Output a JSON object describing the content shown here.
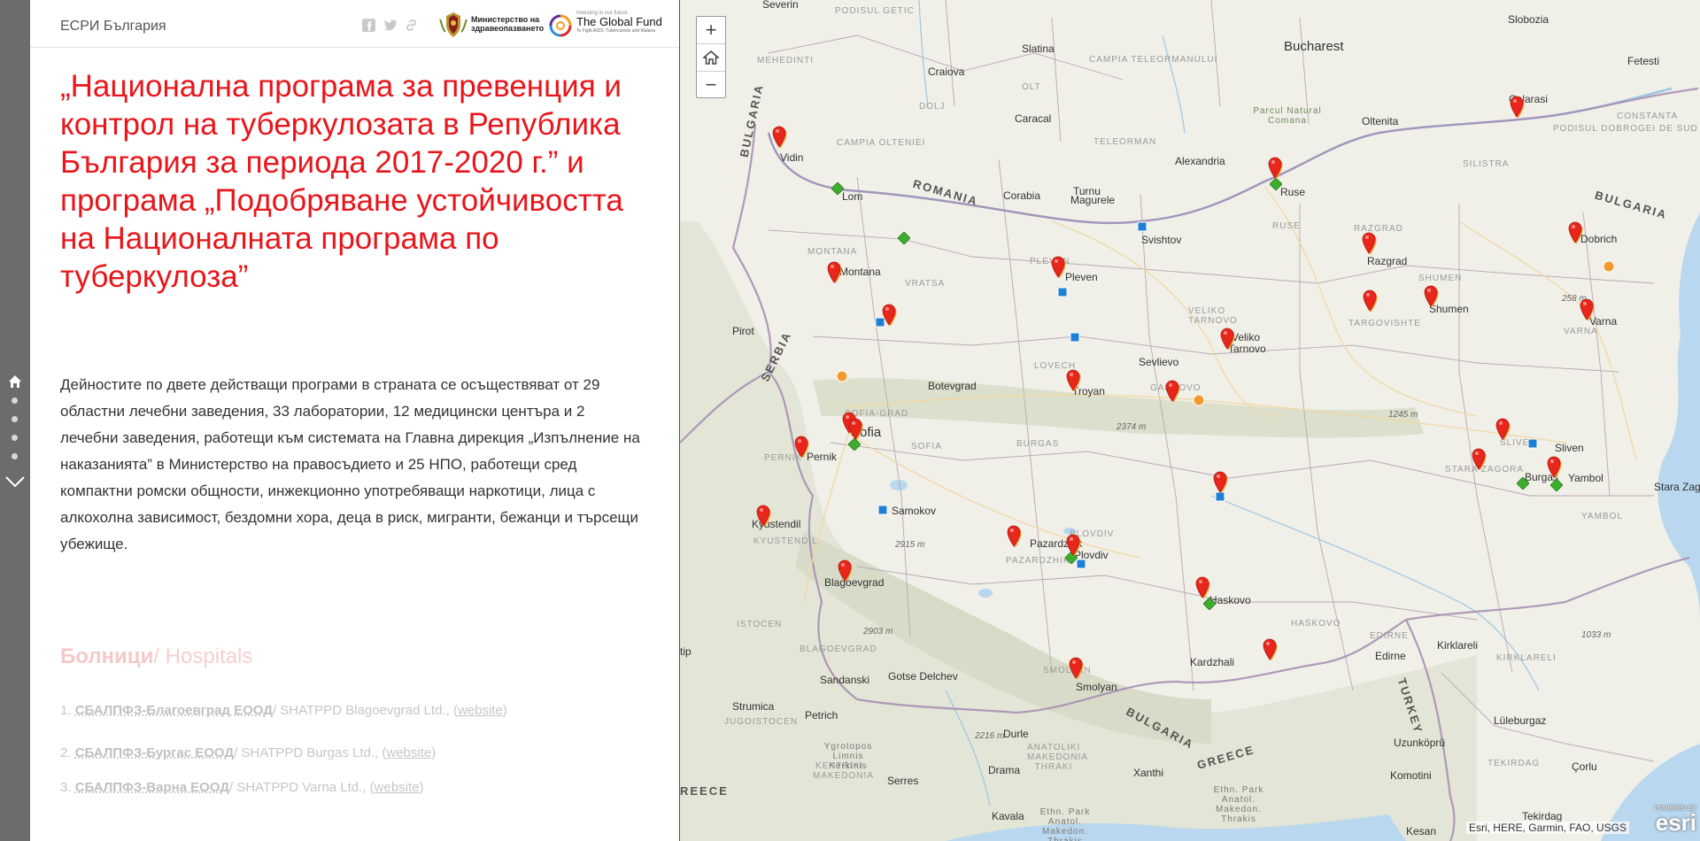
{
  "header": {
    "brand": "ЕСРИ България",
    "logo_moh": "Министерство на здравеопазването",
    "logo_gf_tagline": "Investing in our future",
    "logo_gf_name": "The Global Fund",
    "logo_gf_sub": "To Fight AIDS, Tuberculosis and Malaria"
  },
  "title": "„Национална програма за превенция и контрол на туберкулозата в Република България за периода 2017-2020 г.” и програма „Подобряване устойчивостта на Националната програма по туберкулоза”",
  "intro": "Дейностите по двете действащи програми в страната се осъществяват от 29 областни лечебни заведения, 33 лаборатории, 12 медицински центъра и 2 лечебни заведения, работещи към системата на Главна дирекция „Изпълнение на наказанията” в Министерство на правосъдието и 25 НПО, работещи сред компактни ромски общности, инжекционно употребяващи наркотици, лица с алкохолна зависимост, бездомни хора, деца в риск, мигранти, бежанци и търсещи убежище.",
  "hospitals": {
    "heading_bg": "Болници",
    "heading_en": "/ Hospitals",
    "items": [
      {
        "num": "1.",
        "bg": "СБАЛПФЗ-Благоевград ЕООД",
        "en": "/ SHATPPD Blagoevgrad Ltd., (",
        "link": "website",
        "close": ")"
      },
      {
        "num": "2.",
        "bg": "СБАЛПФЗ-Бургас ЕООД",
        "en": "/ SHATPPD Burgas Ltd., (",
        "link": "website",
        "close": ")"
      },
      {
        "num": "3.",
        "bg": "СБАЛПФЗ-Варна ЕООД",
        "en": "/ SHATPPD Varna Ltd., (",
        "link": "website",
        "close": ")"
      }
    ]
  },
  "map": {
    "zoom_in": "+",
    "zoom_out": "−",
    "attribution": "Esri, HERE, Garmin, FAO, USGS",
    "esri_powered": "POWERED BY",
    "esri_name": "esri",
    "labels": {
      "bucharest": "Bucharest",
      "severin": "Severin",
      "slatina": "Slatina",
      "craiova": "Craiova",
      "caracal": "Caracal",
      "olt": "OLT",
      "alexandria": "Alexandria",
      "turnu": "Turnu",
      "magurele": "Magurele",
      "corabia": "Corabia",
      "giurgiu_area": "CAMPIA TELEORMANULUI",
      "teleorman": "TELEORMAN",
      "campia_olteniei": "CAMPIA OLTENIEI",
      "mehedinti": "MEHEDINTI",
      "dolj": "DOLJ",
      "podisul_getic": "PODISUL GETIC",
      "romania": "ROMANIA",
      "oltenita": "Oltenita",
      "calarasi": "Calarasi",
      "slobozia": "Slobozia",
      "fetesti": "Fetesti",
      "constanta": "CONSTANTA",
      "podisul_dobrogei": "PODISUL DOBROGEI DE SUD",
      "parcul": "Parcul Natural Comana",
      "silistra": "SILISTRA",
      "bulgaria_ne": "BULGARIA",
      "vidin": "Vidin",
      "lom": "Lom",
      "montana": "Montana",
      "montana_r": "MONTANA",
      "vratsa": "VRATSA",
      "pleven": "Pleven",
      "pleven_r": "PLEVEN",
      "svishtov": "Svishtov",
      "ruse": "Ruse",
      "ruse_r": "RUSE",
      "razgrad": "Razgrad",
      "razgrad_r": "RAZGRAD",
      "dobrich": "Dobrich",
      "shumen": "Shumen",
      "shumen_r": "SHUMEN",
      "targovishte": "TARGOVISHTE",
      "varna": "Varna",
      "varna_r": "VARNA",
      "e258": "258 m",
      "pirot": "Pirot",
      "serbia": "SERBIA",
      "bulgaria_nw": "BULGARIA",
      "botevgrad": "Botevgrad",
      "sofia": "Sofia",
      "sofia_grad": "SOFIA-GRAD",
      "sofia_r": "SOFIA",
      "pernik": "Pernik",
      "pernik_r": "PERNIK",
      "lovech": "LOVECH",
      "sevlievo": "Sevlievo",
      "veliko": "Veliko",
      "tarnovo": "Tarnovo",
      "veliko_r": "VELIKO TARNOVO",
      "troyan": "Troyan",
      "gabrovo": "GABROVO",
      "e2374": "2374 m",
      "e1245": "1245 m",
      "sliven": "Sliven",
      "sliven_r": "SLIVEN",
      "burgas": "Burgas",
      "burgas_r": "BURGAS",
      "yambol": "Yambol",
      "yambol_r": "YAMBOL",
      "stara_zagora": "Stara Zagora",
      "stara_zagora_r": "STARA ZAGORA",
      "samokov": "Samokov",
      "kyustendil": "Kyustendil",
      "kyustendil_r": "KYUSTENDIL",
      "e2915": "2915 m",
      "pazardzhik": "Pazardzhik",
      "pazardzhik_r": "PAZARDZHIK",
      "plovdiv": "Plovdiv",
      "plovdiv_r": "PLOVDIV",
      "haskovo": "Haskovo",
      "haskovo_r": "HASKOVO",
      "blagoevgrad": "Blagoevgrad",
      "blagoevgrad_r": "BLAGOEVGRAD",
      "e2903": "2903 m",
      "kardzhali": "Kardzhali",
      "smolyan": "Smolyan",
      "smolyan_r": "SMOLYAN",
      "bulgaria_s": "BULGARIA",
      "greece": "GREECE",
      "turkey": "TURKEY",
      "edirne": "Edirne",
      "edirne_r": "EDIRNE",
      "kirklareli": "Kirklareli",
      "kirklareli_r": "KIRKLARELI",
      "e1033": "1033 m",
      "luleburgaz": "Lüleburgaz",
      "uzunkopru": "Uzunköprü",
      "tekirdag": "TEKIRDAG",
      "tekirdag_c": "Tekirdag",
      "corlu": "Çorlu",
      "kesan": "Kesan",
      "komotini": "Komotini",
      "xanthi": "Xanthi",
      "drama": "Drama",
      "kavala": "Kavala",
      "serres": "Serres",
      "sandanski": "Sandanski",
      "gotse": "Gotse Delchev",
      "petrich": "Petrich",
      "strumica": "Strumica",
      "jugoistocen": "JUGOISTOCEN",
      "istocen": "ISTOCEN",
      "e2216": "2216 m",
      "anatoliki": "ANATOLIKI MAKEDONIA THRAKI",
      "kentriki": "KENTRIKI MAKEDONIA",
      "ethn_park1": "Ethn. Park Anatol. Makedon. Thrakis",
      "ethn_park2": "Ethn. Park Anatol. Makedon. Thrakis",
      "yorotopos": "Ygrotopos Limnis Kerkinis",
      "tip": "tip",
      "reece": "REECE",
      "durle": "Durle",
      "rnov": "rnov"
    }
  },
  "colors": {
    "title_red": "#e8161b",
    "marker_red": "#e8261c",
    "marker_orange": "#f29a2e",
    "marker_green": "#3cad2c",
    "marker_blue": "#1f7fd6"
  }
}
